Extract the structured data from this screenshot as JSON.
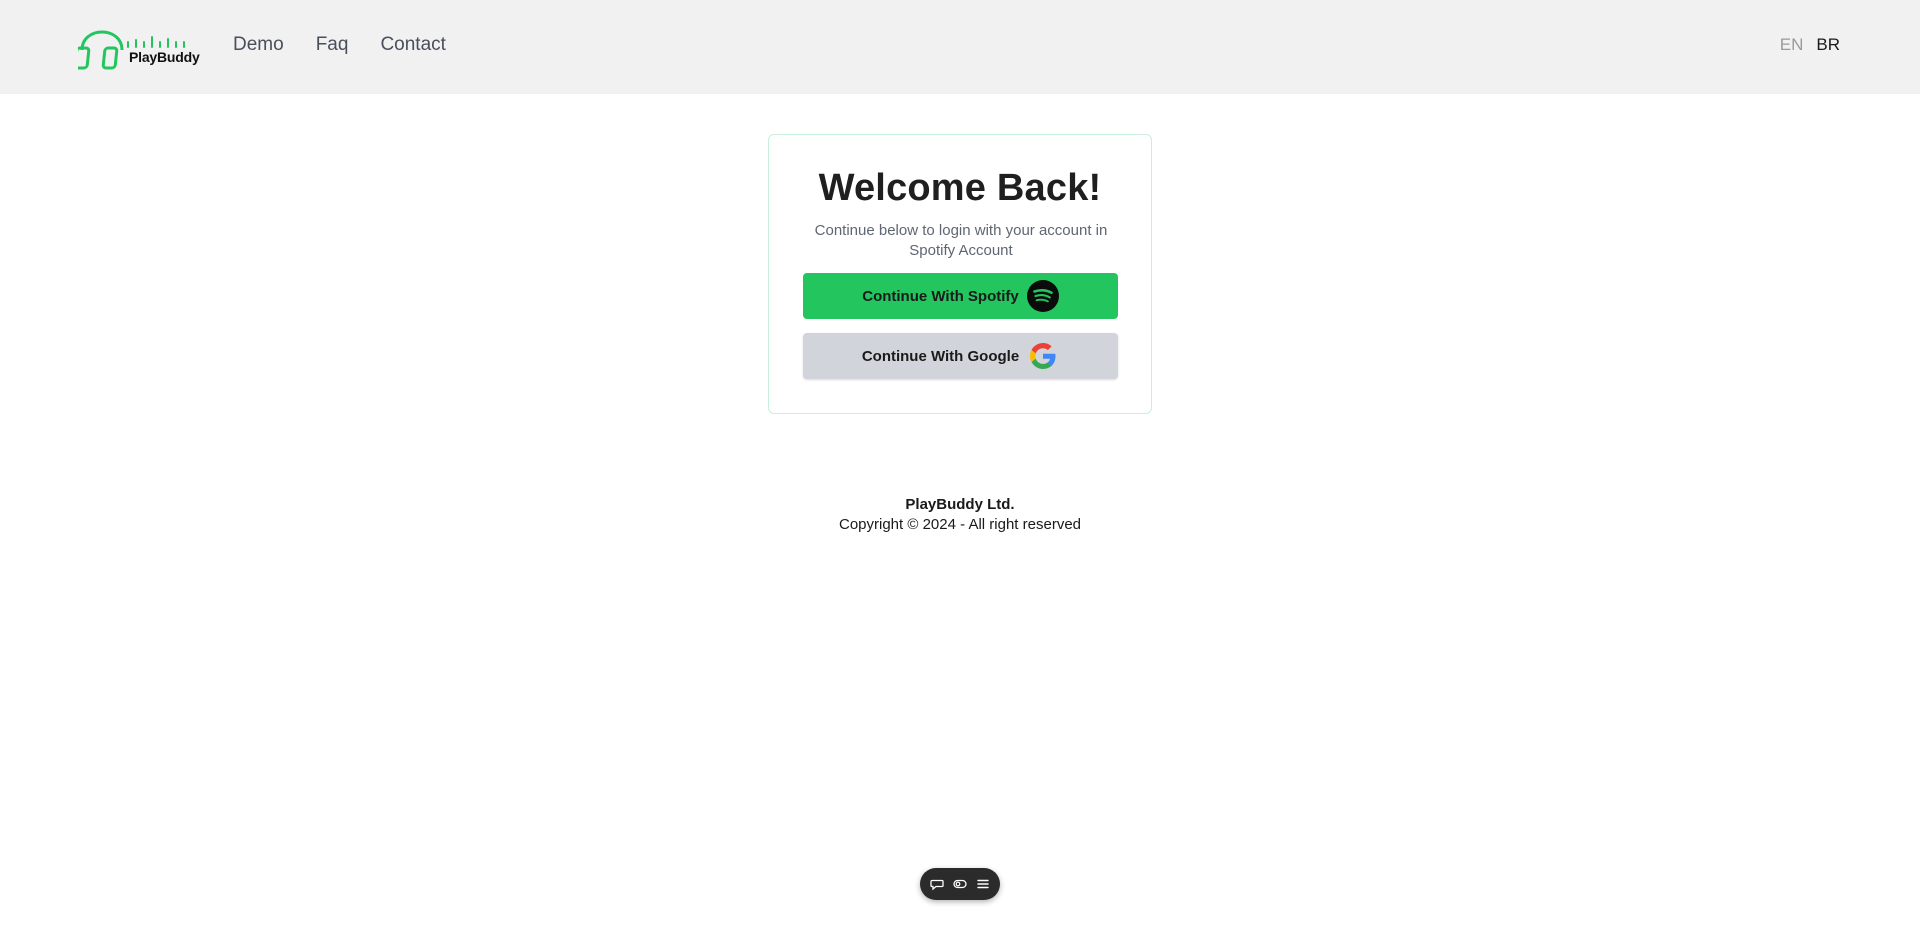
{
  "header": {
    "logo_text": "PlayBuddy",
    "nav": [
      {
        "label": "Demo"
      },
      {
        "label": "Faq"
      },
      {
        "label": "Contact"
      }
    ],
    "languages": {
      "en": "EN",
      "br": "BR"
    }
  },
  "login": {
    "title": "Welcome Back!",
    "subtitle": "Continue below to login with your account in Spotify Account",
    "spotify_button": "Continue With Spotify",
    "google_button": "Continue With Google"
  },
  "footer": {
    "company": "PlayBuddy Ltd.",
    "copyright": "Copyright © 2024 - All right reserved"
  },
  "icons": {
    "logo": "headphones-logo-icon",
    "spotify": "spotify-icon",
    "google": "google-icon",
    "toolbar": [
      "comment-icon",
      "toggle-icon",
      "menu-icon"
    ]
  },
  "colors": {
    "brand_green": "#22c55e",
    "header_bg": "#f1f1f1",
    "google_btn_bg": "#d1d5db"
  }
}
